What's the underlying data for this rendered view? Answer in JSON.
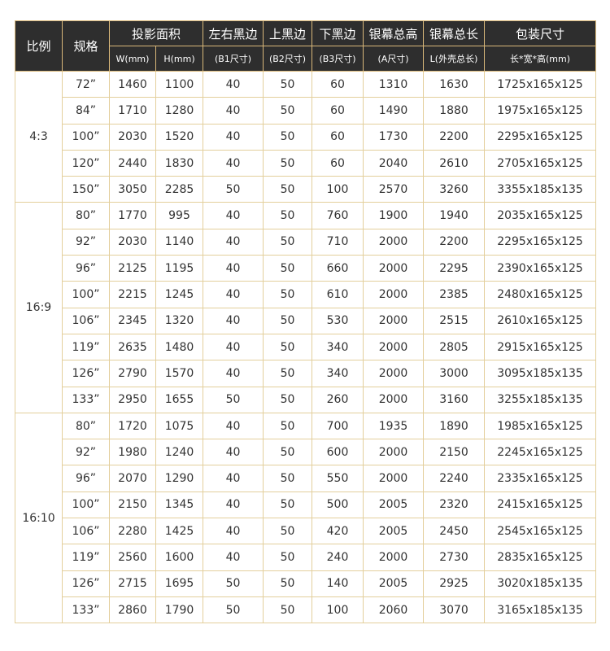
{
  "header": {
    "ratio": "比例",
    "size": "规格",
    "projection_area": "投影面积",
    "lr_border": "左右黑边",
    "top_border": "上黑边",
    "bottom_border": "下黑边",
    "total_height": "银幕总高",
    "total_length": "银幕总长",
    "package_size": "包装尺寸",
    "w_unit": "W(mm)",
    "h_unit": "H(mm)",
    "b1": "(B1尺寸)",
    "b2": "(B2尺寸)",
    "b3": "(B3尺寸)",
    "a": "(A尺寸)",
    "l": "L(外壳总长)",
    "pkg_dims": "长*宽*高(mm)"
  },
  "groups": [
    {
      "ratio": "4:3",
      "rows": [
        [
          "72”",
          "1460",
          "1100",
          "40",
          "50",
          "60",
          "1310",
          "1630",
          "1725x165x125"
        ],
        [
          "84”",
          "1710",
          "1280",
          "40",
          "50",
          "60",
          "1490",
          "1880",
          "1975x165x125"
        ],
        [
          "100”",
          "2030",
          "1520",
          "40",
          "50",
          "60",
          "1730",
          "2200",
          "2295x165x125"
        ],
        [
          "120”",
          "2440",
          "1830",
          "40",
          "50",
          "60",
          "2040",
          "2610",
          "2705x165x125"
        ],
        [
          "150”",
          "3050",
          "2285",
          "50",
          "50",
          "100",
          "2570",
          "3260",
          "3355x185x135"
        ]
      ]
    },
    {
      "ratio": "16:9",
      "rows": [
        [
          "80”",
          "1770",
          "995",
          "40",
          "50",
          "760",
          "1900",
          "1940",
          "2035x165x125"
        ],
        [
          "92”",
          "2030",
          "1140",
          "40",
          "50",
          "710",
          "2000",
          "2200",
          "2295x165x125"
        ],
        [
          "96”",
          "2125",
          "1195",
          "40",
          "50",
          "660",
          "2000",
          "2295",
          "2390x165x125"
        ],
        [
          "100”",
          "2215",
          "1245",
          "40",
          "50",
          "610",
          "2000",
          "2385",
          "2480x165x125"
        ],
        [
          "106”",
          "2345",
          "1320",
          "40",
          "50",
          "530",
          "2000",
          "2515",
          "2610x165x125"
        ],
        [
          "119”",
          "2635",
          "1480",
          "40",
          "50",
          "340",
          "2000",
          "2805",
          "2915x165x125"
        ],
        [
          "126”",
          "2790",
          "1570",
          "40",
          "50",
          "340",
          "2000",
          "3000",
          "3095x185x135"
        ],
        [
          "133”",
          "2950",
          "1655",
          "50",
          "50",
          "260",
          "2000",
          "3160",
          "3255x185x135"
        ]
      ]
    },
    {
      "ratio": "16:10",
      "rows": [
        [
          "80”",
          "1720",
          "1075",
          "40",
          "50",
          "700",
          "1935",
          "1890",
          "1985x165x125"
        ],
        [
          "92”",
          "1980",
          "1240",
          "40",
          "50",
          "600",
          "2000",
          "2150",
          "2245x165x125"
        ],
        [
          "96”",
          "2070",
          "1290",
          "40",
          "50",
          "550",
          "2000",
          "2240",
          "2335x165x125"
        ],
        [
          "100”",
          "2150",
          "1345",
          "40",
          "50",
          "500",
          "2005",
          "2320",
          "2415x165x125"
        ],
        [
          "106”",
          "2280",
          "1425",
          "40",
          "50",
          "420",
          "2005",
          "2450",
          "2545x165x125"
        ],
        [
          "119”",
          "2560",
          "1600",
          "40",
          "50",
          "240",
          "2000",
          "2730",
          "2835x165x125"
        ],
        [
          "126”",
          "2715",
          "1695",
          "50",
          "50",
          "140",
          "2005",
          "2925",
          "3020x185x135"
        ],
        [
          "133”",
          "2860",
          "1790",
          "50",
          "50",
          "100",
          "2060",
          "3070",
          "3165x185x135"
        ]
      ]
    }
  ]
}
